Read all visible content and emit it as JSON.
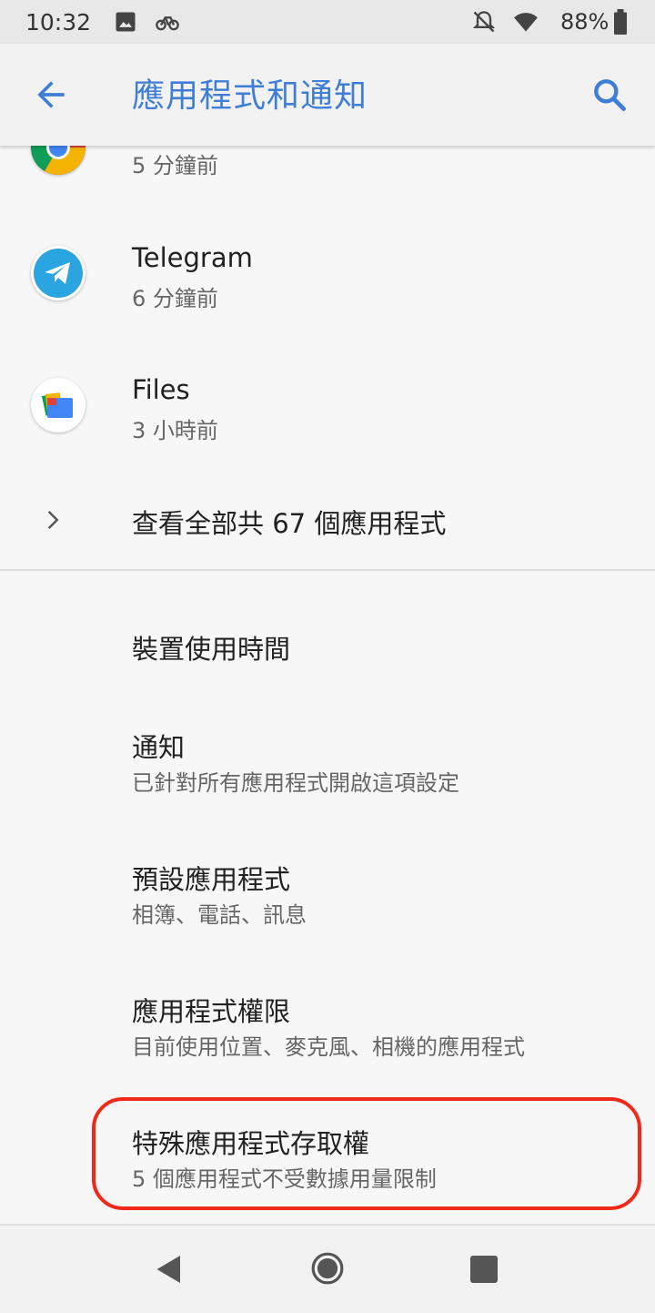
{
  "status_bar": {
    "time": "10:32",
    "battery": "88%",
    "icons": [
      "image-icon",
      "bike-icon",
      "notifications-off-icon",
      "wifi-icon",
      "battery-icon"
    ]
  },
  "toolbar": {
    "title": "應用程式和通知",
    "back_icon": "arrow-back-icon",
    "search_icon": "search-icon",
    "accent": "#3f7ed6"
  },
  "recent_apps": [
    {
      "name": "",
      "time": "5 分鐘前",
      "icon": "chrome-icon"
    },
    {
      "name": "Telegram",
      "time": "6 分鐘前",
      "icon": "telegram-icon"
    },
    {
      "name": "Files",
      "time": "3 小時前",
      "icon": "files-icon"
    }
  ],
  "see_all": {
    "label": "查看全部共 67 個應用程式",
    "icon": "chevron-right-icon"
  },
  "settings": [
    {
      "title": "裝置使用時間",
      "subtitle": ""
    },
    {
      "title": "通知",
      "subtitle": "已針對所有應用程式開啟這項設定"
    },
    {
      "title": "預設應用程式",
      "subtitle": "相簿、電話、訊息"
    },
    {
      "title": "應用程式權限",
      "subtitle": "目前使用位置、麥克風、相機的應用程式"
    },
    {
      "title": "特殊應用程式存取權",
      "subtitle": "5 個應用程式不受數據用量限制",
      "highlighted": true
    }
  ],
  "highlight_color": "#f0291a",
  "nav_bar": {
    "icons": [
      "back-triangle-icon",
      "home-circle-icon",
      "recents-square-icon"
    ]
  }
}
